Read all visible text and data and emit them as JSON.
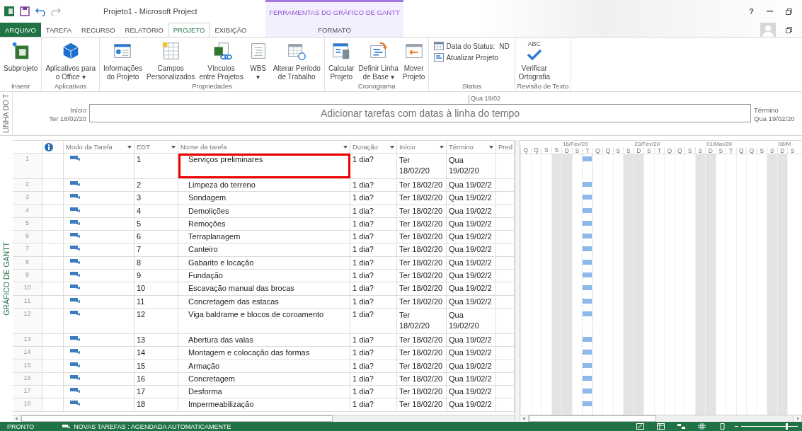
{
  "title_bar": {
    "title": "Projeto1 - Microsoft Project",
    "context_title": "FERRAMENTAS DO GRÁFICO DE GANTT",
    "help": "?"
  },
  "tabs": [
    {
      "label": "ARQUIVO",
      "kind": "file",
      "selected": false
    },
    {
      "label": "TAREFA",
      "kind": "normal",
      "selected": false
    },
    {
      "label": "RECURSO",
      "kind": "normal",
      "selected": false
    },
    {
      "label": "RELATÓRIO",
      "kind": "normal",
      "selected": false
    },
    {
      "label": "PROJETO",
      "kind": "normal",
      "selected": true
    },
    {
      "label": "EXIBIÇÃO",
      "kind": "normal",
      "selected": false
    },
    {
      "label": "FORMATO",
      "kind": "context",
      "selected": false
    }
  ],
  "ribbon": {
    "groups": [
      {
        "label": "Inserir",
        "kind": "large",
        "buttons": [
          {
            "kind": "subproject",
            "lines": [
              "Subprojeto"
            ]
          }
        ]
      },
      {
        "label": "Aplicativos",
        "kind": "large",
        "buttons": [
          {
            "kind": "apps",
            "lines": [
              "Aplicativos para",
              "o Office ▾"
            ]
          }
        ]
      },
      {
        "label": "Propriedades",
        "kind": "large",
        "buttons": [
          {
            "kind": "info",
            "lines": [
              "Informações",
              "do Projeto"
            ]
          },
          {
            "kind": "fields",
            "lines": [
              "Campos",
              "Personalizados"
            ]
          },
          {
            "kind": "links",
            "lines": [
              "Vínculos",
              "entre Projetos"
            ]
          },
          {
            "kind": "wbs",
            "lines": [
              "WBS",
              "▾"
            ]
          },
          {
            "kind": "calendar",
            "lines": [
              "Alterar Período",
              "de Trabalho"
            ]
          }
        ]
      },
      {
        "label": "Cronograma",
        "kind": "large",
        "buttons": [
          {
            "kind": "calc",
            "lines": [
              "Calcular",
              "Projeto"
            ]
          },
          {
            "kind": "baseline",
            "lines": [
              "Definir Linha",
              "de Base ▾"
            ]
          },
          {
            "kind": "move",
            "lines": [
              "Mover",
              "Projeto"
            ]
          }
        ]
      },
      {
        "label": "Status",
        "kind": "small",
        "items": [
          {
            "kind": "calendar",
            "label": "Data do Status:",
            "value": "ND"
          },
          {
            "kind": "update",
            "label": "Atualizar Projeto"
          }
        ]
      },
      {
        "label": "Revisão de Texto",
        "kind": "large",
        "buttons": [
          {
            "kind": "spell",
            "icon_text": "ABC",
            "lines": [
              "Verificar",
              "Ortografia"
            ]
          }
        ]
      }
    ]
  },
  "timeline": {
    "side_label": "LINHA DO T",
    "start_label": "Início",
    "start_date": "Ter 18/02/20",
    "placeholder": "Adicionar tarefas com datas à linha do tempo",
    "marker": "Qua 19/02",
    "finish_label": "Término",
    "finish_date": "Qua 19/02/20"
  },
  "side_label": "GRÁFICO DE GANTT",
  "table": {
    "columns": [
      {
        "kind": "info",
        "filter": false
      },
      {
        "label": "Modo da Tarefa",
        "kind": "text",
        "filter": true
      },
      {
        "label": "EDT",
        "kind": "text",
        "filter": true
      },
      {
        "label": "Nome da tarefa",
        "kind": "text",
        "filter": true
      },
      {
        "label": "Duração",
        "kind": "text",
        "filter": true
      },
      {
        "label": "Início",
        "kind": "text",
        "filter": true
      },
      {
        "label": "Término",
        "kind": "text",
        "filter": true
      },
      {
        "label": "Pred",
        "kind": "text",
        "filter": false
      }
    ],
    "rows": [
      {
        "id": "1",
        "wbs": "1",
        "name": "Serviços preliminares",
        "duration": "1 dia?",
        "start": "Ter 18/02/20",
        "finish": "Qua 19/02/20",
        "wrapped": true,
        "highlighted": true
      },
      {
        "id": "2",
        "wbs": "2",
        "name": "Limpeza do terreno",
        "duration": "1 dia?",
        "start": "Ter 18/02/20",
        "finish": "Qua 19/02/2",
        "wrapped": false,
        "highlighted": false
      },
      {
        "id": "3",
        "wbs": "3",
        "name": "Sondagem",
        "duration": "1 dia?",
        "start": "Ter 18/02/20",
        "finish": "Qua 19/02/2",
        "wrapped": false,
        "highlighted": false
      },
      {
        "id": "4",
        "wbs": "4",
        "name": "Demolições",
        "duration": "1 dia?",
        "start": "Ter 18/02/20",
        "finish": "Qua 19/02/2",
        "wrapped": false,
        "highlighted": false
      },
      {
        "id": "5",
        "wbs": "5",
        "name": "Remoções",
        "duration": "1 dia?",
        "start": "Ter 18/02/20",
        "finish": "Qua 19/02/2",
        "wrapped": false,
        "highlighted": false
      },
      {
        "id": "6",
        "wbs": "6",
        "name": "Terraplanagem",
        "duration": "1 dia?",
        "start": "Ter 18/02/20",
        "finish": "Qua 19/02/2",
        "wrapped": false,
        "highlighted": false
      },
      {
        "id": "7",
        "wbs": "7",
        "name": "Canteiro",
        "duration": "1 dia?",
        "start": "Ter 18/02/20",
        "finish": "Qua 19/02/2",
        "wrapped": false,
        "highlighted": false
      },
      {
        "id": "8",
        "wbs": "8",
        "name": "Gabarito e locação",
        "duration": "1 dia?",
        "start": "Ter 18/02/20",
        "finish": "Qua 19/02/2",
        "wrapped": false,
        "highlighted": false
      },
      {
        "id": "9",
        "wbs": "9",
        "name": "Fundação",
        "duration": "1 dia?",
        "start": "Ter 18/02/20",
        "finish": "Qua 19/02/2",
        "wrapped": false,
        "highlighted": false
      },
      {
        "id": "10",
        "wbs": "10",
        "name": "Escavação manual das brocas",
        "duration": "1 dia?",
        "start": "Ter 18/02/20",
        "finish": "Qua 19/02/2",
        "wrapped": false,
        "highlighted": false
      },
      {
        "id": "11",
        "wbs": "11",
        "name": "Concretagem das estacas",
        "duration": "1 dia?",
        "start": "Ter 18/02/20",
        "finish": "Qua 19/02/2",
        "wrapped": false,
        "highlighted": false
      },
      {
        "id": "12",
        "wbs": "12",
        "name": "Viga baldrame e blocos de coroamento",
        "duration": "1 dia?",
        "start": "Ter 18/02/20",
        "finish": "Qua 19/02/20",
        "wrapped": true,
        "highlighted": false
      },
      {
        "id": "13",
        "wbs": "13",
        "name": "Abertura das valas",
        "duration": "1 dia?",
        "start": "Ter 18/02/20",
        "finish": "Qua 19/02/2",
        "wrapped": false,
        "highlighted": false
      },
      {
        "id": "14",
        "wbs": "14",
        "name": "Montagem e colocação das formas",
        "duration": "1 dia?",
        "start": "Ter 18/02/20",
        "finish": "Qua 19/02/2",
        "wrapped": false,
        "highlighted": false
      },
      {
        "id": "15",
        "wbs": "15",
        "name": "Armação",
        "duration": "1 dia?",
        "start": "Ter 18/02/20",
        "finish": "Qua 19/02/2",
        "wrapped": false,
        "highlighted": false
      },
      {
        "id": "16",
        "wbs": "16",
        "name": "Concretagem",
        "duration": "1 dia?",
        "start": "Ter 18/02/20",
        "finish": "Qua 19/02/2",
        "wrapped": false,
        "highlighted": false
      },
      {
        "id": "17",
        "wbs": "17",
        "name": "Desforma",
        "duration": "1 dia?",
        "start": "Ter 18/02/20",
        "finish": "Qua 19/02/2",
        "wrapped": false,
        "highlighted": false
      },
      {
        "id": "18",
        "wbs": "18",
        "name": "Impermeabilização",
        "duration": "1 dia?",
        "start": "Ter 18/02/20",
        "finish": "Qua 19/02/2",
        "wrapped": false,
        "highlighted": false
      }
    ]
  },
  "gantt": {
    "weeks": [
      {
        "days": [
          {
            "letter": "Q",
            "weekend": false,
            "bars": false
          },
          {
            "letter": "Q",
            "weekend": false,
            "bars": false
          },
          {
            "letter": "S",
            "weekend": false,
            "bars": false
          },
          {
            "letter": "S",
            "weekend": true,
            "bars": false
          }
        ]
      },
      {
        "label": "16/Fev/20",
        "days": [
          {
            "letter": "D",
            "weekend": true,
            "bars": false
          },
          {
            "letter": "S",
            "weekend": false,
            "bars": false
          },
          {
            "letter": "T",
            "weekend": false,
            "bars": true
          },
          {
            "letter": "Q",
            "weekend": false,
            "bars": false
          },
          {
            "letter": "Q",
            "weekend": false,
            "bars": false
          },
          {
            "letter": "S",
            "weekend": false,
            "bars": false
          },
          {
            "letter": "S",
            "weekend": true,
            "bars": false
          }
        ]
      },
      {
        "label": "23/Fev/20",
        "days": [
          {
            "letter": "D",
            "weekend": true,
            "bars": false
          },
          {
            "letter": "S",
            "weekend": false,
            "bars": false
          },
          {
            "letter": "T",
            "weekend": false,
            "bars": false
          },
          {
            "letter": "Q",
            "weekend": false,
            "bars": false
          },
          {
            "letter": "Q",
            "weekend": false,
            "bars": false
          },
          {
            "letter": "S",
            "weekend": false,
            "bars": false
          },
          {
            "letter": "S",
            "weekend": true,
            "bars": false
          }
        ]
      },
      {
        "label": "01/Mar/20",
        "days": [
          {
            "letter": "D",
            "weekend": true,
            "bars": false
          },
          {
            "letter": "S",
            "weekend": false,
            "bars": false
          },
          {
            "letter": "T",
            "weekend": false,
            "bars": false
          },
          {
            "letter": "Q",
            "weekend": false,
            "bars": false
          },
          {
            "letter": "Q",
            "weekend": false,
            "bars": false
          },
          {
            "letter": "S",
            "weekend": false,
            "bars": false
          },
          {
            "letter": "S",
            "weekend": true,
            "bars": false
          }
        ]
      },
      {
        "label": "08/M",
        "days": [
          {
            "letter": "D",
            "weekend": true,
            "bars": false
          },
          {
            "letter": "S",
            "weekend": false,
            "bars": false
          }
        ]
      }
    ]
  },
  "status_bar": {
    "ready": "PRONTO",
    "new_tasks": "NOVAS TAREFAS : AGENDADA AUTOMATICAMENTE",
    "zoom": {
      "level": 0.8
    }
  }
}
